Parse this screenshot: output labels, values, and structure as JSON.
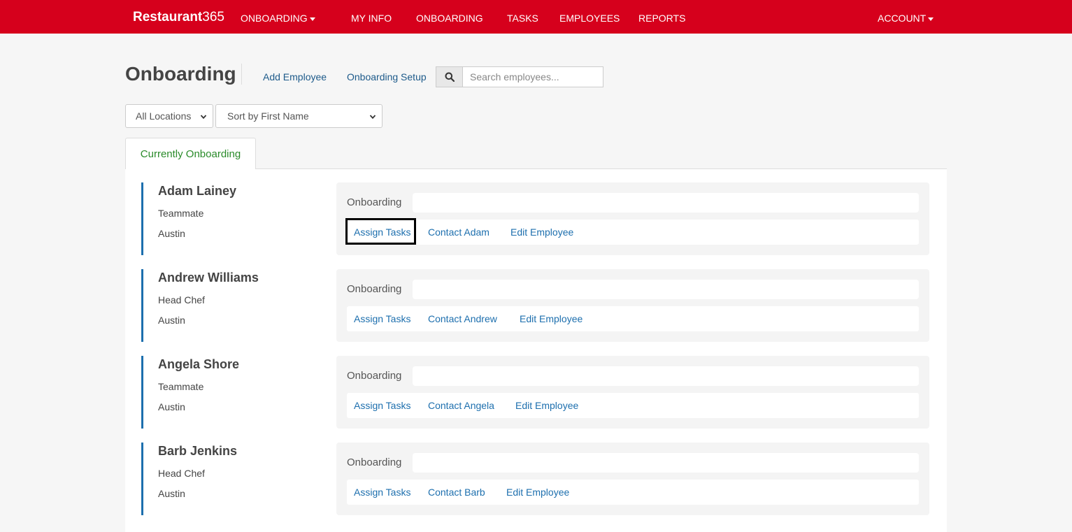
{
  "brand": {
    "bold": "Restaurant",
    "light": "365"
  },
  "topnav": {
    "product_menu": "ONBOARDING",
    "items": [
      "MY INFO",
      "ONBOARDING",
      "TASKS",
      "EMPLOYEES",
      "REPORTS"
    ],
    "account": "ACCOUNT"
  },
  "header": {
    "title": "Onboarding",
    "add_employee": "Add Employee",
    "onboarding_setup": "Onboarding Setup",
    "search_placeholder": "Search employees..."
  },
  "filters": {
    "location": "All Locations",
    "sort": "Sort by First Name"
  },
  "tabs": {
    "active": "Currently Onboarding"
  },
  "employees": [
    {
      "name": "Adam Lainey",
      "role": "Teammate",
      "location": "Austin",
      "status": "Onboarding",
      "assign": "Assign Tasks",
      "contact": "Contact Adam",
      "edit": "Edit Employee"
    },
    {
      "name": "Andrew Williams",
      "role": "Head Chef",
      "location": "Austin",
      "status": "Onboarding",
      "assign": "Assign Tasks",
      "contact": "Contact Andrew",
      "edit": "Edit Employee"
    },
    {
      "name": "Angela Shore",
      "role": "Teammate",
      "location": "Austin",
      "status": "Onboarding",
      "assign": "Assign Tasks",
      "contact": "Contact Angela",
      "edit": "Edit Employee"
    },
    {
      "name": "Barb Jenkins",
      "role": "Head Chef",
      "location": "Austin",
      "status": "Onboarding",
      "assign": "Assign Tasks",
      "contact": "Contact Barb",
      "edit": "Edit Employee"
    }
  ],
  "colors": {
    "brand_red": "#d6001c",
    "link_blue": "#1d6fae",
    "tab_green": "#2a8b2a"
  }
}
